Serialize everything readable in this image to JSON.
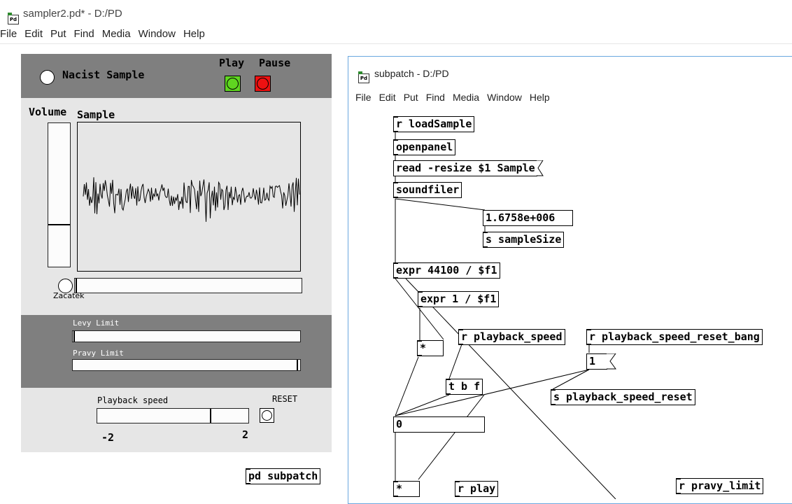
{
  "main_window": {
    "title": "sampler2.pd* - D:/PD",
    "menu": [
      "File",
      "Edit",
      "Put",
      "Find",
      "Media",
      "Window",
      "Help"
    ]
  },
  "gui": {
    "header": {
      "sample_title": "Nacist Sample",
      "play_label": "Play",
      "pause_label": "Pause",
      "play_color": "#5fd520",
      "pause_color": "#ee1111",
      "bg_color": "#7f7f7f"
    },
    "volume_label": "Volume",
    "volume_level": 0.31,
    "sample_label": "Sample",
    "start_label": "Zacatek",
    "start_position": 0.0,
    "left_limit_label": "Levy Limit",
    "left_limit_value": 0.0,
    "right_limit_label": "Pravy Limit",
    "right_limit_value": 1.0,
    "playback_label": "Playback speed",
    "reset_label": "RESET",
    "playback_min": "-2",
    "playback_max": "2",
    "playback_value": 1.0
  },
  "pd_subpatch_label": "pd subpatch",
  "sub_window": {
    "title": "subpatch - D:/PD",
    "menu": [
      "File",
      "Edit",
      "Put",
      "Find",
      "Media",
      "Window",
      "Help"
    ],
    "objects": {
      "r_loadsample": "r loadSample",
      "openpanel": "openpanel",
      "read_msg": "read -resize $1 Sample",
      "soundfiler": "soundfiler",
      "atom_size": "1.6758e+006",
      "s_samplesize": "s sampleSize",
      "expr_44100": "expr 44100 / $f1",
      "expr_1": "expr 1 / $f1",
      "mult1": "*",
      "r_playback_speed": "r playback_speed",
      "r_playback_speed_reset_bang": "r playback_speed_reset_bang",
      "msg_1": "1",
      "t_b_f": "t b f",
      "s_playback_speed_reset": "s playback_speed_reset",
      "atom_0": "0",
      "mult2": "*",
      "r_play": "r play",
      "r_pravy_limit": "r pravy_limit"
    }
  }
}
